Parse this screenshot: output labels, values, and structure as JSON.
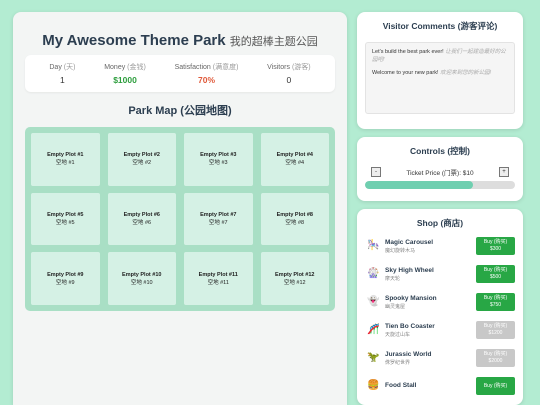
{
  "header": {
    "title": "My Awesome Theme Park",
    "title_zh": "我的超棒主题公园"
  },
  "stats": [
    {
      "label": "Day",
      "label_zh": "(天)",
      "value": "1",
      "kind": "plain"
    },
    {
      "label": "Money",
      "label_zh": "(金钱)",
      "value": "$1000",
      "kind": "money"
    },
    {
      "label": "Satisfaction",
      "label_zh": "(满意度)",
      "value": "70%",
      "kind": "sat"
    },
    {
      "label": "Visitors",
      "label_zh": "(游客)",
      "value": "0",
      "kind": "plain"
    }
  ],
  "map": {
    "title": "Park Map (公园地图)",
    "plots": [
      {
        "en": "Empty Plot #1",
        "zh": "空地 #1"
      },
      {
        "en": "Empty Plot #2",
        "zh": "空地 #2"
      },
      {
        "en": "Empty Plot #3",
        "zh": "空地 #3"
      },
      {
        "en": "Empty Plot #4",
        "zh": "空地 #4"
      },
      {
        "en": "Empty Plot #5",
        "zh": "空地 #5"
      },
      {
        "en": "Empty Plot #6",
        "zh": "空地 #6"
      },
      {
        "en": "Empty Plot #7",
        "zh": "空地 #7"
      },
      {
        "en": "Empty Plot #8",
        "zh": "空地 #8"
      },
      {
        "en": "Empty Plot #9",
        "zh": "空地 #9"
      },
      {
        "en": "Empty Plot #10",
        "zh": "空地 #10"
      },
      {
        "en": "Empty Plot #11",
        "zh": "空地 #11"
      },
      {
        "en": "Empty Plot #12",
        "zh": "空地 #12"
      }
    ]
  },
  "comments": {
    "title": "Visitor Comments (游客评论)",
    "items": [
      {
        "en": "Let's build the best park ever!",
        "zh": "让我们一起建造最好的公园吧!"
      },
      {
        "en": "Welcome to your new park!",
        "zh": "欢迎来到您的新公园!"
      }
    ]
  },
  "controls": {
    "title": "Controls (控制)",
    "ticket_label": "Ticket Price (门票): $10",
    "minus": "-",
    "plus": "+",
    "ticket_level": 0.72
  },
  "shop": {
    "title": "Shop (商店)",
    "items": [
      {
        "name": "Magic Carousel",
        "zh": "魔幻旋转木马",
        "buy": "Buy (购买)",
        "price": "$300",
        "available": true,
        "icon": "carousel-icon",
        "glyph": "🎠"
      },
      {
        "name": "Sky High Wheel",
        "zh": "摩天轮",
        "buy": "Buy (购买)",
        "price": "$500",
        "available": true,
        "icon": "ferris-wheel-icon",
        "glyph": "🎡"
      },
      {
        "name": "Spooky Mansion",
        "zh": "幽灵鬼屋",
        "buy": "Buy (购买)",
        "price": "$750",
        "available": true,
        "icon": "ghost-icon",
        "glyph": "👻"
      },
      {
        "name": "Tien Bo Coaster",
        "zh": "天旋过山车",
        "buy": "Buy (购买)",
        "price": "$1200",
        "available": false,
        "icon": "roller-coaster-icon",
        "glyph": "🎢"
      },
      {
        "name": "Jurassic World",
        "zh": "侏罗纪世界",
        "buy": "Buy (购买)",
        "price": "$2000",
        "available": false,
        "icon": "dinosaur-icon",
        "glyph": "🦖"
      },
      {
        "name": "Food Stall",
        "zh": "",
        "buy": "Buy (购买)",
        "price": "",
        "available": true,
        "icon": "food-icon",
        "glyph": "🍔"
      }
    ]
  },
  "colors": {
    "background": "#b3ecd2",
    "money": "#2e9e3e",
    "satisfaction": "#e05a3b",
    "buy_enabled": "#28a745",
    "buy_disabled": "#c8c8c8",
    "map_bg": "#a9dfc5"
  }
}
